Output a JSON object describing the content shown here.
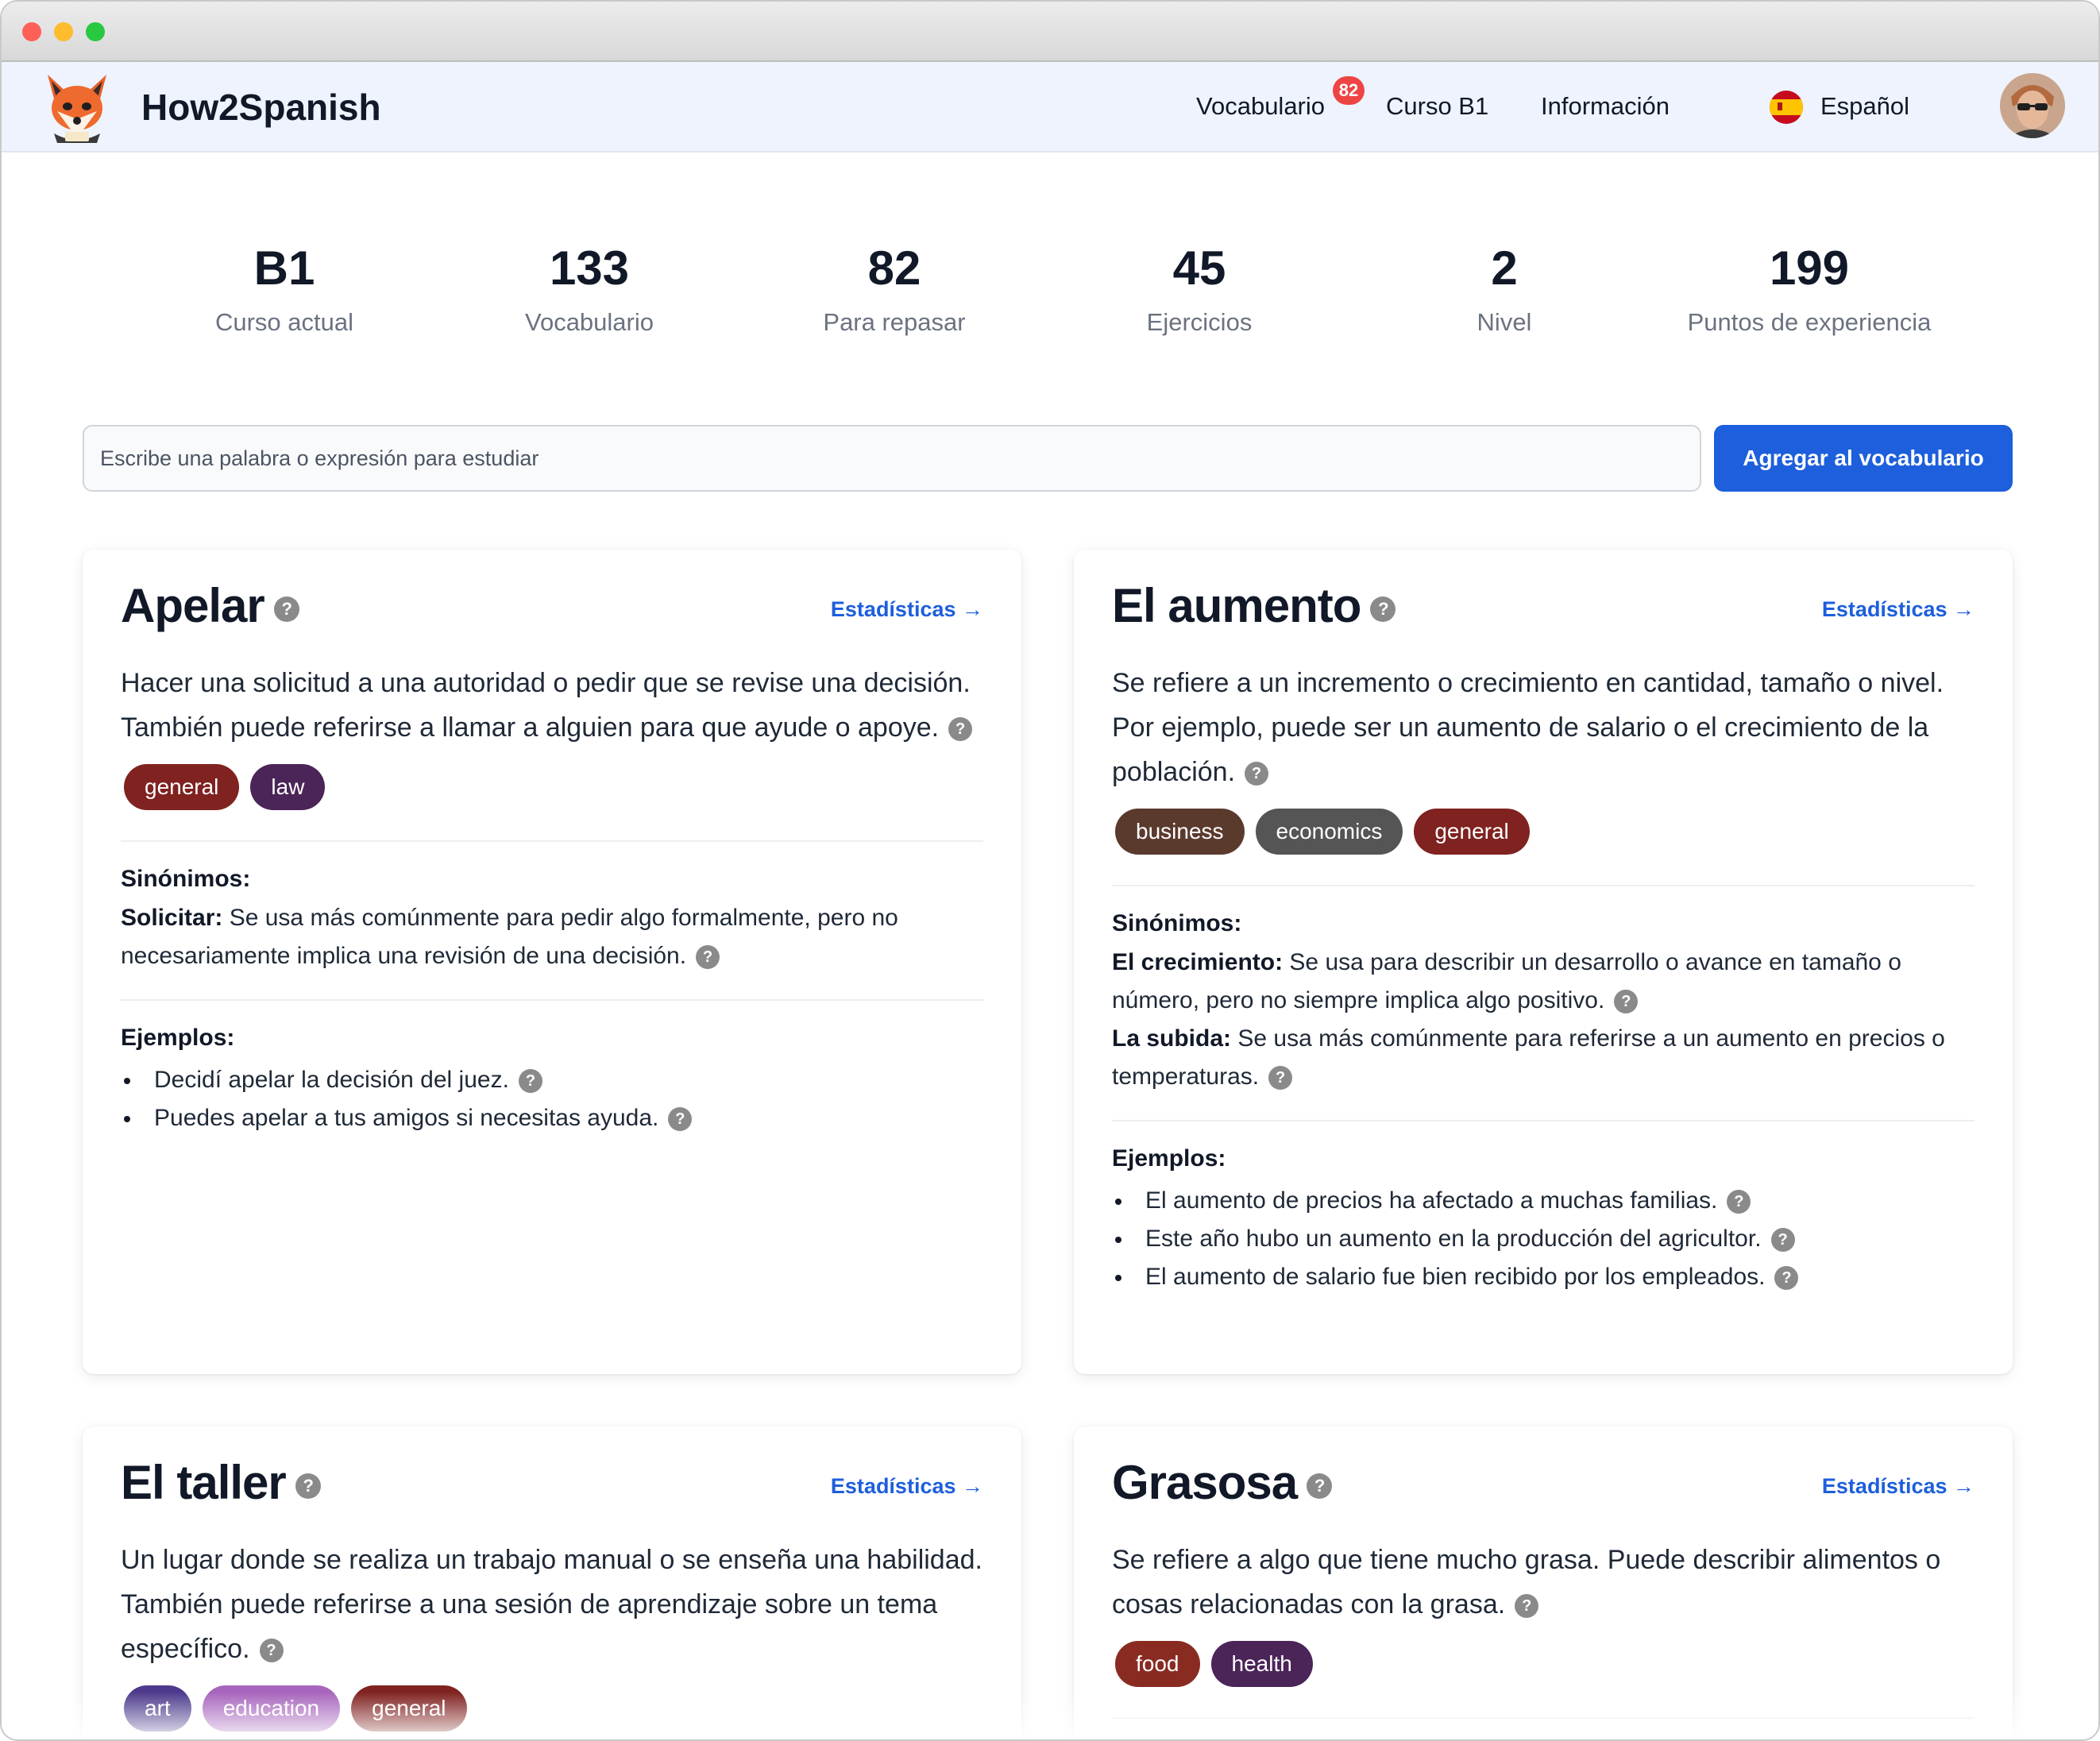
{
  "app": {
    "brand": "How2Spanish"
  },
  "nav": {
    "vocab": "Vocabulario",
    "vocab_badge": "82",
    "course": "Curso B1",
    "info": "Información",
    "language": "Español"
  },
  "stats": [
    {
      "value": "B1",
      "label": "Curso actual"
    },
    {
      "value": "133",
      "label": "Vocabulario"
    },
    {
      "value": "82",
      "label": "Para repasar"
    },
    {
      "value": "45",
      "label": "Ejercicios"
    },
    {
      "value": "2",
      "label": "Nivel"
    },
    {
      "value": "199",
      "label": "Puntos de experiencia"
    }
  ],
  "search": {
    "placeholder": "Escribe una palabra o expresión para estudiar",
    "value": "",
    "button": "Agregar al vocabulario"
  },
  "labels": {
    "stats_link": "Estadísticas →",
    "synonyms": "Sinónimos:",
    "examples": "Ejemplos:",
    "help_icon": "?"
  },
  "tag_colors": {
    "general": "#7f2220",
    "law": "#4b2458",
    "business": "#5b3a2e",
    "economics": "#555555",
    "art": "#4d3a8c",
    "education": "#a765bd",
    "food": "#8a2b22",
    "health": "#4b2458"
  },
  "cards": [
    {
      "word": "Apelar",
      "definition": "Hacer una solicitud a una autoridad o pedir que se revise una decisión. También puede referirse a llamar a alguien para que ayude o apoye.",
      "tags": [
        "general",
        "law"
      ],
      "synonyms": [
        {
          "term": "Solicitar:",
          "text": "Se usa más comúnmente para pedir algo formalmente, pero no necesariamente implica una revisión de una decisión."
        }
      ],
      "examples": [
        "Decidí apelar la decisión del juez.",
        "Puedes apelar a tus amigos si necesitas ayuda."
      ]
    },
    {
      "word": "El aumento",
      "definition": "Se refiere a un incremento o crecimiento en cantidad, tamaño o nivel. Por ejemplo, puede ser un aumento de salario o el crecimiento de la población.",
      "tags": [
        "business",
        "economics",
        "general"
      ],
      "synonyms": [
        {
          "term": "El crecimiento:",
          "text": "Se usa para describir un desarrollo o avance en tamaño o número, pero no siempre implica algo positivo."
        },
        {
          "term": "La subida:",
          "text": "Se usa más comúnmente para referirse a un aumento en precios o temperaturas."
        }
      ],
      "examples": [
        "El aumento de precios ha afectado a muchas familias.",
        "Este año hubo un aumento en la producción del agricultor.",
        "El aumento de salario fue bien recibido por los empleados."
      ]
    },
    {
      "word": "El taller",
      "definition": "Un lugar donde se realiza un trabajo manual o se enseña una habilidad. También puede referirse a una sesión de aprendizaje sobre un tema específico.",
      "tags": [
        "art",
        "education",
        "general"
      ],
      "synonyms": [],
      "examples": []
    },
    {
      "word": "Grasosa",
      "definition": "Se refiere a algo que tiene mucho grasa. Puede describir alimentos o cosas relacionadas con la grasa.",
      "tags": [
        "food",
        "health"
      ],
      "synonyms": [],
      "examples": []
    }
  ]
}
